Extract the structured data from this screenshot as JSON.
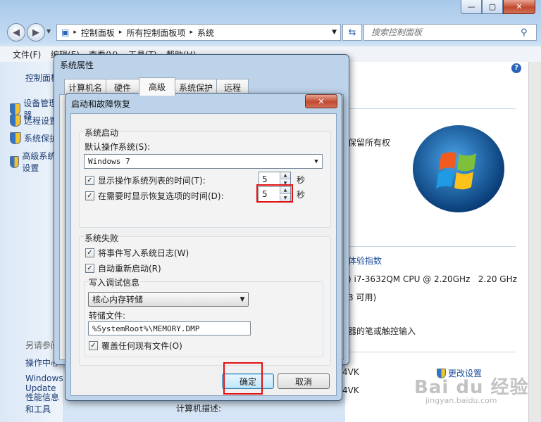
{
  "explorer": {
    "breadcrumb": [
      "控制面板",
      "所有控制面板项",
      "系统"
    ],
    "search_placeholder": "搜索控制面板",
    "menu": [
      "文件(F)",
      "编辑(E)",
      "查看(V)",
      "工具(T)",
      "帮助(H)"
    ],
    "left_top_link": "控制面板",
    "left_links": [
      "设备管理器",
      "远程设置",
      "系统保护",
      "高级系统设置"
    ],
    "see_also": "另请参阅",
    "see_also_links": [
      "操作中心",
      "Windows Update",
      "性能信息和工具"
    ],
    "right_texts": {
      "copyright": "保留所有权",
      "experience": "体验指数",
      "cpu": ") i7-3632QM CPU @ 2.20GHz   2.20 GHz",
      "ram": "3 可用)",
      "pen": "器的笔或触控输入",
      "key1": "4VK",
      "key2": "4VK",
      "change_settings": "更改设置",
      "computer_desc": "计算机描述:"
    },
    "watermark": "Bai du 经验",
    "watermark_sub": "jingyan.baidu.com"
  },
  "sysprops": {
    "title": "系统属性",
    "tabs": [
      "计算机名",
      "硬件",
      "高级",
      "系统保护",
      "远程"
    ],
    "active_tab": "高级"
  },
  "dialog": {
    "title": "启动和故障恢复",
    "close": "✕",
    "startup": {
      "group_label": "系统启动",
      "default_os_label": "默认操作系统(S):",
      "default_os_value": "Windows 7",
      "show_list_label": "显示操作系统列表的时间(T):",
      "show_list_checked": true,
      "show_list_value": "5",
      "show_recovery_label": "在需要时显示恢复选项的时间(D):",
      "show_recovery_checked": true,
      "show_recovery_value": "5",
      "unit": "秒"
    },
    "failure": {
      "group_label": "系统失败",
      "write_event_label": "将事件写入系统日志(W)",
      "write_event_checked": true,
      "auto_restart_label": "自动重新启动(R)",
      "auto_restart_checked": true,
      "debug_group_label": "写入调试信息",
      "debug_type": "核心内存转储",
      "dump_file_label": "转储文件:",
      "dump_file_value": "%SystemRoot%\\MEMORY.DMP",
      "overwrite_label": "覆盖任何现有文件(O)",
      "overwrite_checked": true
    },
    "ok": "确定",
    "cancel": "取消"
  }
}
